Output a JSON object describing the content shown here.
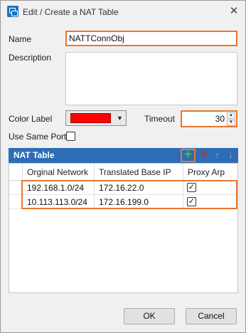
{
  "window": {
    "title": "Edit / Create a NAT Table",
    "close_glyph": "✕"
  },
  "form": {
    "name_label": "Name",
    "name_value": "NATTConnObj",
    "description_label": "Description",
    "description_value": "",
    "color_label": "Color Label",
    "color_value": "#ff0000",
    "timeout_label": "Timeout",
    "timeout_value": "30",
    "use_same_port_label": "Use Same Port",
    "use_same_port_checked": false
  },
  "nat_table": {
    "title": "NAT Table",
    "toolbar": {
      "add_icon": "plus-icon",
      "delete_icon": "x-icon",
      "up_icon": "arrow-up-icon",
      "down_icon": "arrow-down-icon"
    },
    "columns": [
      "Orginal Network",
      "Translated Base IP",
      "Proxy Arp"
    ],
    "rows": [
      {
        "original_network": "192.168.1.0/24",
        "translated_base_ip": "172.16.22.0",
        "proxy_arp": true
      },
      {
        "original_network": "10.113.113.0/24",
        "translated_base_ip": "172.16.199.0",
        "proxy_arp": true
      }
    ]
  },
  "buttons": {
    "ok": "OK",
    "cancel": "Cancel"
  },
  "colors": {
    "header_blue": "#2e6db5",
    "highlight_orange": "#e8762d",
    "color_label_red": "#ff0000"
  }
}
